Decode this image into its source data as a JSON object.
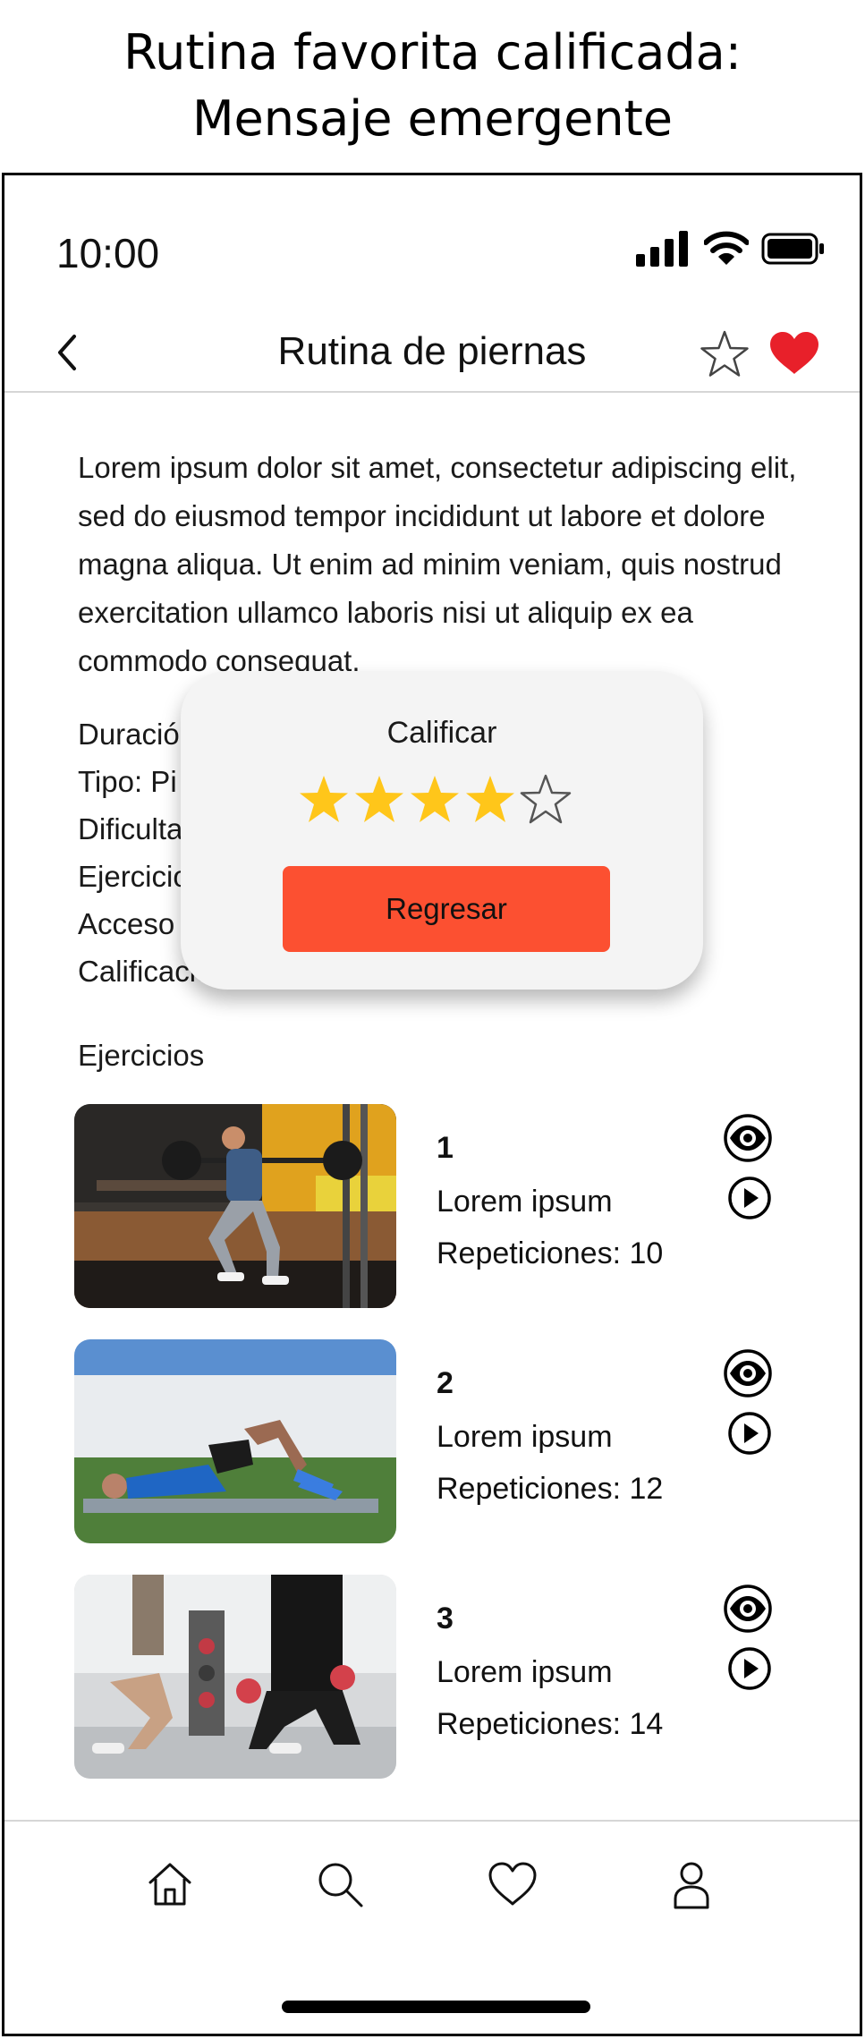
{
  "caption": {
    "line1": "Rutina favorita calificada:",
    "line2": "Mensaje emergente"
  },
  "status_bar": {
    "time": "10:00",
    "icons": [
      "signal-icon",
      "wifi-icon",
      "battery-icon"
    ]
  },
  "header": {
    "title": "Rutina de piernas",
    "back_icon": "chevron-left-icon",
    "rate_icon": "star-outline-icon",
    "favorite_icon": "heart-filled-icon",
    "favorite_color": "#e8202a"
  },
  "description": "Lorem ipsum dolor sit amet, consectetur adipiscing elit, sed do eiusmod tempor incididunt ut labore et dolore magna aliqua. Ut enim ad minim veniam, quis nostrud exercitation ullamco laboris nisi ut aliquip ex ea commodo consequat.",
  "details": [
    "Duración",
    "Tipo: Pi",
    "Dificulta",
    "Ejercicio",
    "Acceso",
    "Calificació"
  ],
  "exercises_label": "Ejercicios",
  "exercises": [
    {
      "number": "1",
      "name": "Lorem ipsum",
      "reps": "Repeticiones: 10"
    },
    {
      "number": "2",
      "name": "Lorem ipsum",
      "reps": "Repeticiones: 12"
    },
    {
      "number": "3",
      "name": "Lorem ipsum",
      "reps": "Repeticiones: 14"
    }
  ],
  "popup": {
    "title": "Calificar",
    "rating": 4,
    "rating_max": 5,
    "star_color": "#ffc61a",
    "button_label": "Regresar",
    "button_color": "#fc5031"
  },
  "tabbar": {
    "items": [
      "home-icon",
      "search-icon",
      "heart-icon",
      "profile-icon"
    ]
  }
}
